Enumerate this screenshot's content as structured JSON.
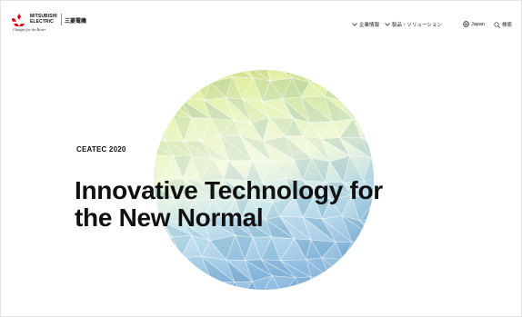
{
  "header": {
    "brand_name_line1": "MITSUBISHI",
    "brand_name_line2": "ELECTRIC",
    "brand_tagline": "Changes for the Better",
    "brand_name_jp": "三菱電機",
    "nav": {
      "corporate_label": "企業情報",
      "products_label": "製品・ソリューション",
      "region_label": "Japan",
      "search_label": "検索"
    }
  },
  "hero": {
    "eyebrow": "CEATEC 2020",
    "headline_line1": "Innovative Technology for",
    "headline_line2": "the New Normal"
  },
  "colors": {
    "brand_red": "#e60012",
    "sphere_top": "#d6e86a",
    "sphere_mid": "#e8f6c2",
    "sphere_bottom": "#8fc2e6"
  },
  "icons": {
    "corporate": "chevron-down-icon",
    "products": "chevron-down-icon",
    "region": "globe-icon",
    "search": "search-icon"
  }
}
